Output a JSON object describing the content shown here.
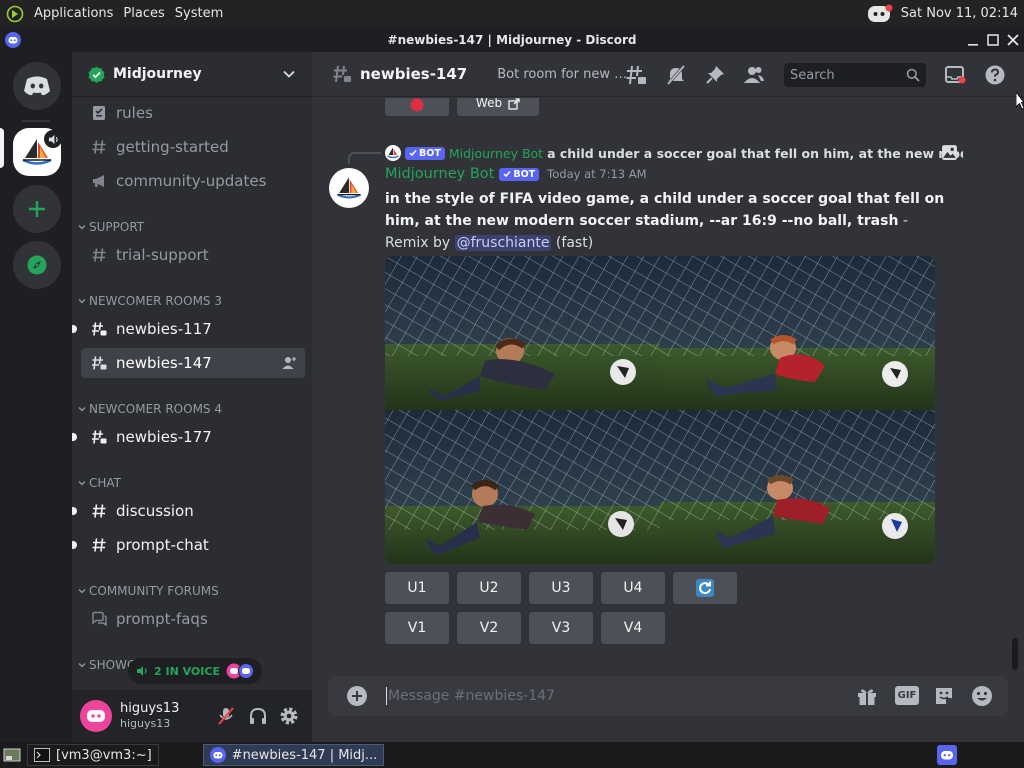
{
  "os_panel": {
    "applications": "Applications",
    "places": "Places",
    "system": "System",
    "datetime": "Sat Nov 11, 02:14"
  },
  "window": {
    "title": "#newbies-147 | Midjourney - Discord"
  },
  "server": {
    "name": "Midjourney"
  },
  "channels": {
    "rules": "rules",
    "getting_started": "getting-started",
    "community_updates": "community-updates",
    "cat_support": "SUPPORT",
    "trial_support": "trial-support",
    "cat_newcomer3": "NEWCOMER ROOMS 3",
    "newbies_117": "newbies-117",
    "newbies_147": "newbies-147",
    "cat_newcomer4": "NEWCOMER ROOMS 4",
    "newbies_177": "newbies-177",
    "cat_chat": "CHAT",
    "discussion": "discussion",
    "prompt_chat": "prompt-chat",
    "cat_forums": "COMMUNITY FORUMS",
    "prompt_faqs": "prompt-faqs",
    "cat_show": "SHOWC"
  },
  "voice": {
    "label": "2 IN VOICE"
  },
  "user": {
    "name": "higuys13",
    "tag": "higuys13"
  },
  "header": {
    "channel": "newbies-147",
    "topic": "Bot room for new us...",
    "search_placeholder": "Search"
  },
  "message": {
    "prev_button_label": "Web",
    "reply_bot_tag": "BOT",
    "reply_author": "Midjourney Bot",
    "reply_text": "a child under a soccer goal that fell on him, at the new modern s",
    "author": "Midjourney Bot",
    "bot_tag": "BOT",
    "timestamp": "Today at 7:13 AM",
    "prompt": "in the style of FIFA video game, a child under a soccer goal that fell on him, at the new modern soccer stadium, --ar 16:9 --no ball, trash",
    "suffix": " - Remix by ",
    "mention": "@fruschiante",
    "mode": " (fast)"
  },
  "buttons": {
    "u1": "U1",
    "u2": "U2",
    "u3": "U3",
    "u4": "U4",
    "v1": "V1",
    "v2": "V2",
    "v3": "V3",
    "v4": "V4"
  },
  "composer": {
    "placeholder": "Message #newbies-147",
    "gif": "GIF"
  },
  "taskbar": {
    "terminal": "[vm3@vm3:~]",
    "discord": "#newbies-147 | Midj..."
  },
  "colors": {
    "blurple": "#5865f2",
    "green": "#23a55a",
    "link": "#00a8fc",
    "mention_bg": "#3c4270"
  }
}
